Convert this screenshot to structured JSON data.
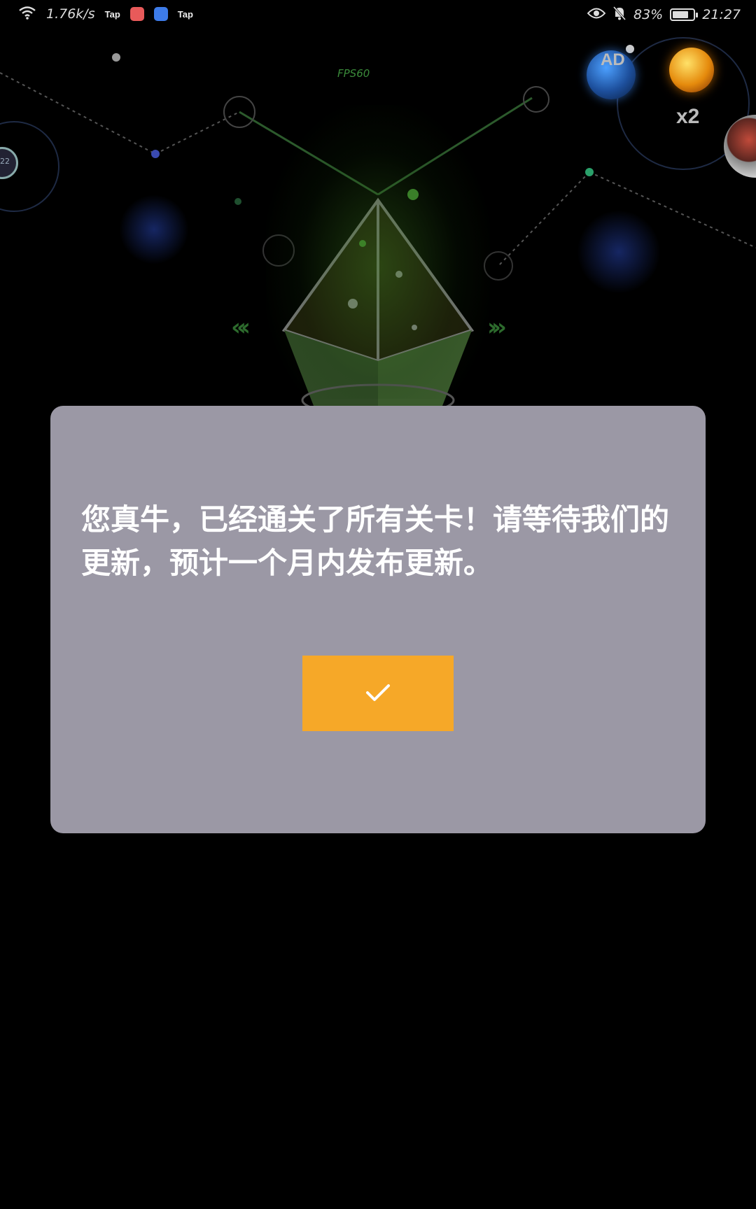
{
  "status_bar": {
    "net_speed": "1.76k/s",
    "apps": [
      "Tap",
      "Tap"
    ],
    "battery_percent": "83%",
    "time": "21:27",
    "battery_level": 0.83
  },
  "game": {
    "fps": "FPS60",
    "ad_label": "AD",
    "multiplier": "x2",
    "left_planet_label": "22"
  },
  "dialog": {
    "message": "您真牛，已经通关了所有关卡！请等待我们的更新，预计一个月内发布更新。",
    "confirm_icon": "checkmark-icon"
  },
  "colors": {
    "dialog_bg": "#9b98a5",
    "button": "#f6a828",
    "background": "#000000"
  }
}
